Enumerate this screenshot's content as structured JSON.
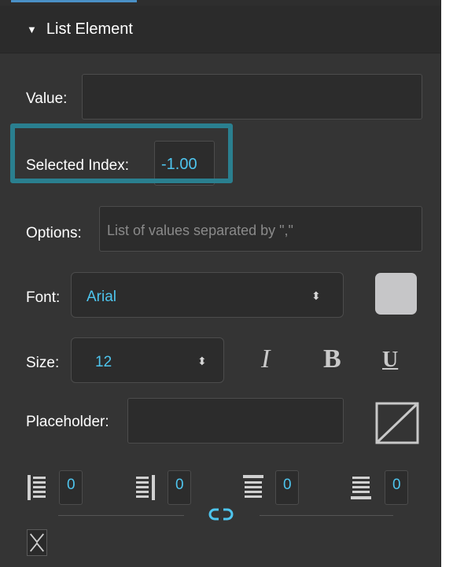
{
  "section": {
    "title": "List Element",
    "caret": "▼"
  },
  "value_row": {
    "label": "Value:",
    "value": ""
  },
  "selected_index_row": {
    "label": "Selected Index:",
    "value": "-1.00"
  },
  "options_row": {
    "label": "Options:",
    "placeholder": "List of values separated by \",\""
  },
  "font_row": {
    "label": "Font:",
    "value": "Arial",
    "arrows": "⬍"
  },
  "swatch": {
    "color": "#c6c6c8"
  },
  "size_row": {
    "label": "Size:",
    "value": "12",
    "arrows": "⬍"
  },
  "style_buttons": {
    "italic": "I",
    "bold": "B",
    "underline": "U"
  },
  "placeholder_row": {
    "label": "Placeholder:",
    "value": ""
  },
  "padding": {
    "left": "0",
    "right": "0",
    "top": "0",
    "bottom": "0"
  },
  "colors": {
    "panel": "#343434",
    "header": "#2b2b2b",
    "accent": "#4ec5ee",
    "highlight": "#2a7f8f"
  }
}
